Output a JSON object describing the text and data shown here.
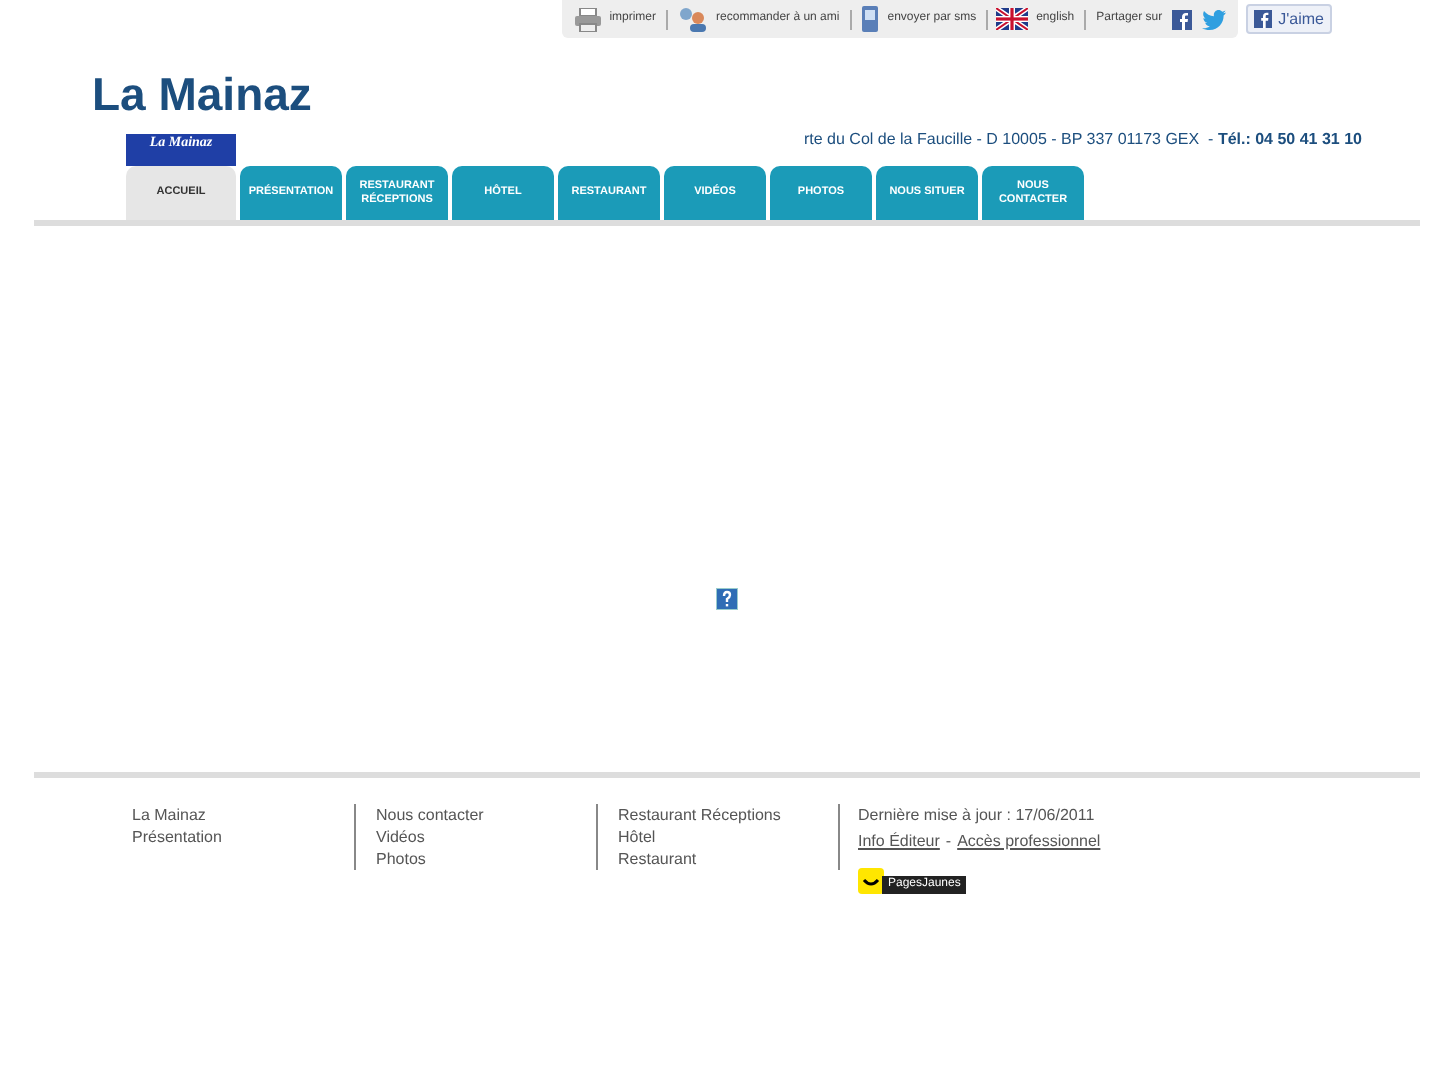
{
  "toolbar": {
    "items": [
      {
        "kind": "print",
        "label": "imprimer"
      },
      {
        "kind": "friend",
        "label": "recommander à un ami"
      },
      {
        "kind": "sms",
        "label": "envoyer par sms"
      },
      {
        "kind": "flag",
        "label": "english"
      }
    ],
    "share_label": "Partager sur",
    "like_button": "J'aime"
  },
  "site_title": "La Mainaz",
  "logo": {
    "line1": "La",
    "line2": "Mainaz"
  },
  "address": "rte du Col de la Faucille - D 10005 - BP 337 01173 GEX  - ",
  "phone": "Tél.: 04 50 41 31 10",
  "tabs": [
    {
      "label": "ACCUEIL",
      "selected": true
    },
    {
      "label": "PRÉSENTATION",
      "selected": false
    },
    {
      "label": "RESTAURANT RÉCEPTIONS",
      "selected": false
    },
    {
      "label": "HÔTEL",
      "selected": false
    },
    {
      "label": "RESTAURANT",
      "selected": false
    },
    {
      "label": "VIDÉOS",
      "selected": false
    },
    {
      "label": "PHOTOS",
      "selected": false
    },
    {
      "label": "NOUS SITUER",
      "selected": false
    },
    {
      "label": "NOUS CONTACTER",
      "selected": false
    }
  ],
  "footer": {
    "columns": [
      [
        "La Mainaz",
        "Présentation"
      ],
      [
        "Nous contacter",
        "Vidéos",
        "Photos"
      ],
      [
        "Restaurant Réceptions",
        "Hôtel",
        "Restaurant"
      ]
    ],
    "updated": "Dernière mise à jour : 17/06/2011",
    "links": [
      "Info Éditeur",
      "Accès professionnel"
    ],
    "separator": "-",
    "badge": "PagesJaunes"
  }
}
